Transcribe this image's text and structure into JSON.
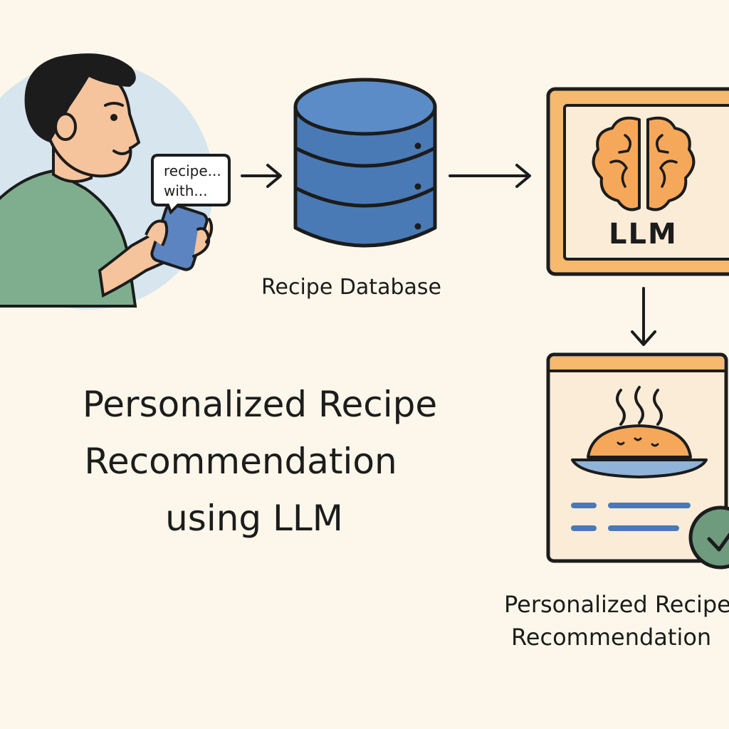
{
  "user": {
    "query_lines": [
      "recipe...",
      "with..."
    ]
  },
  "database": {
    "label": "Recipe Database"
  },
  "llm": {
    "label": "LLM"
  },
  "title": {
    "lines": [
      "Personalized Recipe",
      "Recommendation",
      "using LLM"
    ]
  },
  "result": {
    "label_lines": [
      "Personalized Recipe",
      "Recommendation"
    ]
  },
  "colors": {
    "background": "#fcf7ea",
    "database_blue": "#4a7ab5",
    "llm_orange": "#f6b96e",
    "shirt_green": "#7fae8e",
    "check_green": "#6e9a7e",
    "outline": "#1c1c1c"
  },
  "icons": [
    "person-with-phone",
    "database-icon",
    "brain-icon",
    "food-dish-icon",
    "checkmark-icon",
    "arrow-right-icon",
    "arrow-down-icon"
  ]
}
